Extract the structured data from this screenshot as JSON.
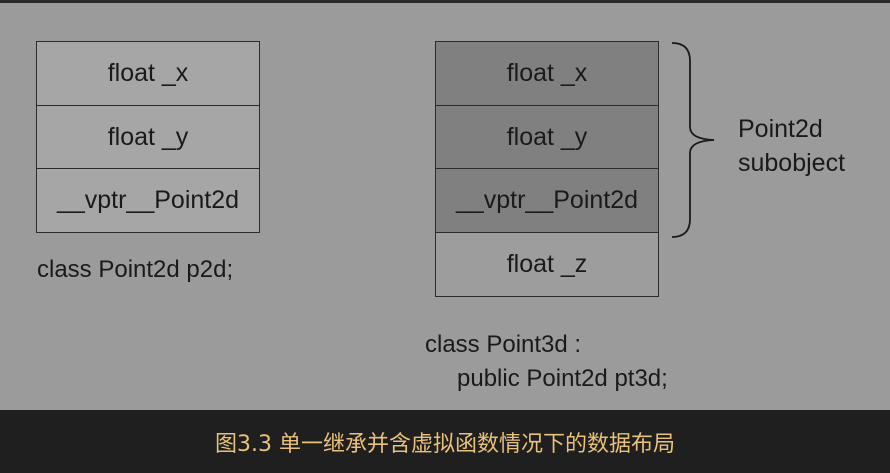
{
  "left": {
    "cells": [
      "float _x",
      "float _y",
      "__vptr__Point2d"
    ],
    "caption": "class Point2d p2d;"
  },
  "right": {
    "cells": [
      "float _x",
      "float _y",
      "__vptr__Point2d",
      "float _z"
    ],
    "caption_line1": "class Point3d :",
    "caption_line2": "public Point2d pt3d;",
    "brace_label_line1": "Point2d",
    "brace_label_line2": "subobject"
  },
  "footer": {
    "caption": "图3.3 单一继承并含虚拟函数情况下的数据布局"
  },
  "colors": {
    "figure_bg": "#9b9b9b",
    "shaded_cell": "#808080",
    "footer_bg": "#1f1f1f",
    "footer_text": "#e9c178"
  }
}
